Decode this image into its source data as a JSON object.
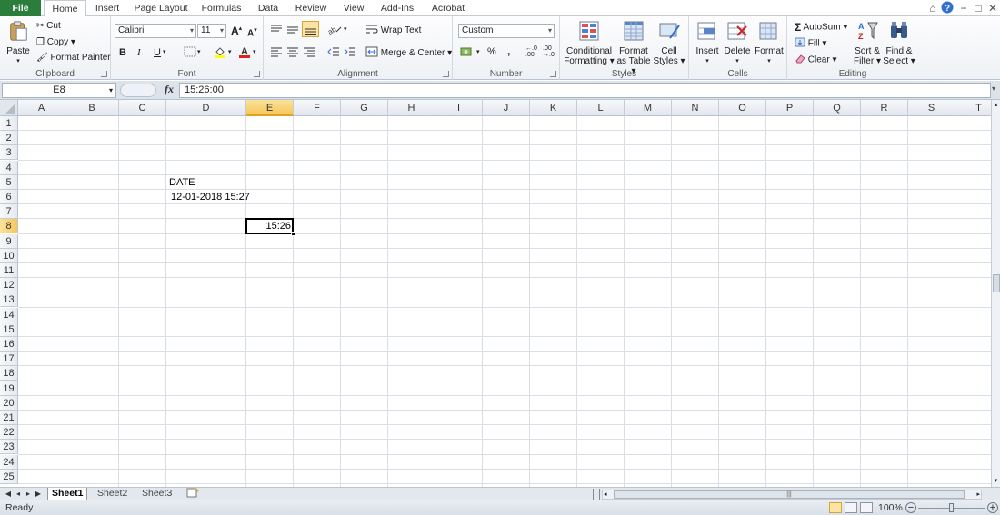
{
  "tabs": [
    "File",
    "Home",
    "Insert",
    "Page Layout",
    "Formulas",
    "Data",
    "Review",
    "View",
    "Add-Ins",
    "Acrobat"
  ],
  "ribbon": {
    "clipboard": {
      "label": "Clipboard",
      "paste": "Paste",
      "cut": "Cut",
      "copy": "Copy",
      "format_painter": "Format Painter"
    },
    "font": {
      "label": "Font",
      "name": "Calibri",
      "size": "11",
      "bold": "B",
      "italic": "I",
      "underline": "U"
    },
    "alignment": {
      "label": "Alignment",
      "wrap_text": "Wrap Text",
      "merge_center": "Merge & Center"
    },
    "number": {
      "label": "Number",
      "format": "Custom",
      "percent": "%",
      "comma": ",",
      "inc_decimal": ".0→.00",
      "dec_decimal": ".00→.0"
    },
    "styles": {
      "label": "Styles",
      "conditional_1": "Conditional",
      "conditional_2": "Formatting",
      "format_table_1": "Format",
      "format_table_2": "as Table",
      "cell_styles_1": "Cell",
      "cell_styles_2": "Styles"
    },
    "cells": {
      "label": "Cells",
      "insert": "Insert",
      "delete": "Delete",
      "format": "Format"
    },
    "editing": {
      "label": "Editing",
      "autosum": "AutoSum",
      "fill": "Fill",
      "clear": "Clear",
      "sort_1": "Sort &",
      "sort_2": "Filter",
      "find_1": "Find &",
      "find_2": "Select"
    }
  },
  "formula_bar": {
    "name_box": "E8",
    "fx": "fx",
    "formula": "15:26:00"
  },
  "grid": {
    "columns": [
      "A",
      "B",
      "C",
      "D",
      "E",
      "F",
      "G",
      "H",
      "I",
      "J",
      "K",
      "L",
      "M",
      "N",
      "O",
      "P",
      "Q",
      "R",
      "S",
      "T"
    ],
    "rows": [
      "1",
      "2",
      "3",
      "4",
      "5",
      "6",
      "7",
      "8",
      "9",
      "10",
      "11",
      "12",
      "13",
      "14",
      "15",
      "16",
      "17",
      "18",
      "19",
      "20",
      "21",
      "22",
      "23",
      "24",
      "25"
    ],
    "selected_column": "E",
    "selected_row": "8",
    "cells": {
      "D5": "DATE",
      "D6": "12-01-2018 15:27",
      "E8": "15:26"
    }
  },
  "sheets": [
    "Sheet1",
    "Sheet2",
    "Sheet3"
  ],
  "active_sheet": "Sheet1",
  "status": {
    "mode": "Ready",
    "zoom": "100%"
  },
  "colors": {
    "file_tab": "#2a7d3a",
    "selection_header": "#f6c65a",
    "grid_line": "#dadfe6"
  }
}
